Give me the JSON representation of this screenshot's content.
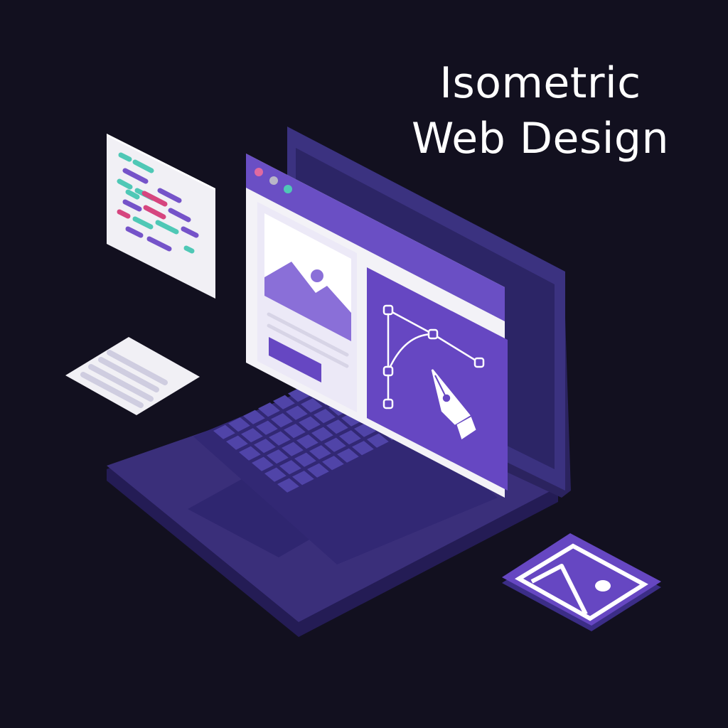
{
  "title": {
    "line1": "Isometric",
    "line2": "Web Design"
  },
  "colors": {
    "background": "#12101f",
    "laptop_body": "#3a2f7a",
    "laptop_body_side": "#2a2160",
    "laptop_lid": "#3b3280",
    "laptop_screen": "#2c2566",
    "keys": "#5044a8",
    "trackpad": "#2f2670",
    "window_bar": "#6a4fc4",
    "window_body": "#f3f2f7",
    "accent_purple": "#6647c2",
    "image_placeholder": "#8a6fd8",
    "code_teal": "#4fc8b6",
    "code_purple": "#7553c9",
    "code_pink": "#d6457f",
    "dot_pink": "#e06aa0",
    "dot_grey": "#b9b6c8",
    "dot_teal": "#4fc8b6",
    "card_white": "#f1f0f5",
    "card_lines": "#cfcde0"
  },
  "icons": {
    "image_icon": "image-icon",
    "pen_tool_icon": "pen-tool-icon",
    "code_icon": "code-icon",
    "text_document_icon": "text-document-icon"
  }
}
